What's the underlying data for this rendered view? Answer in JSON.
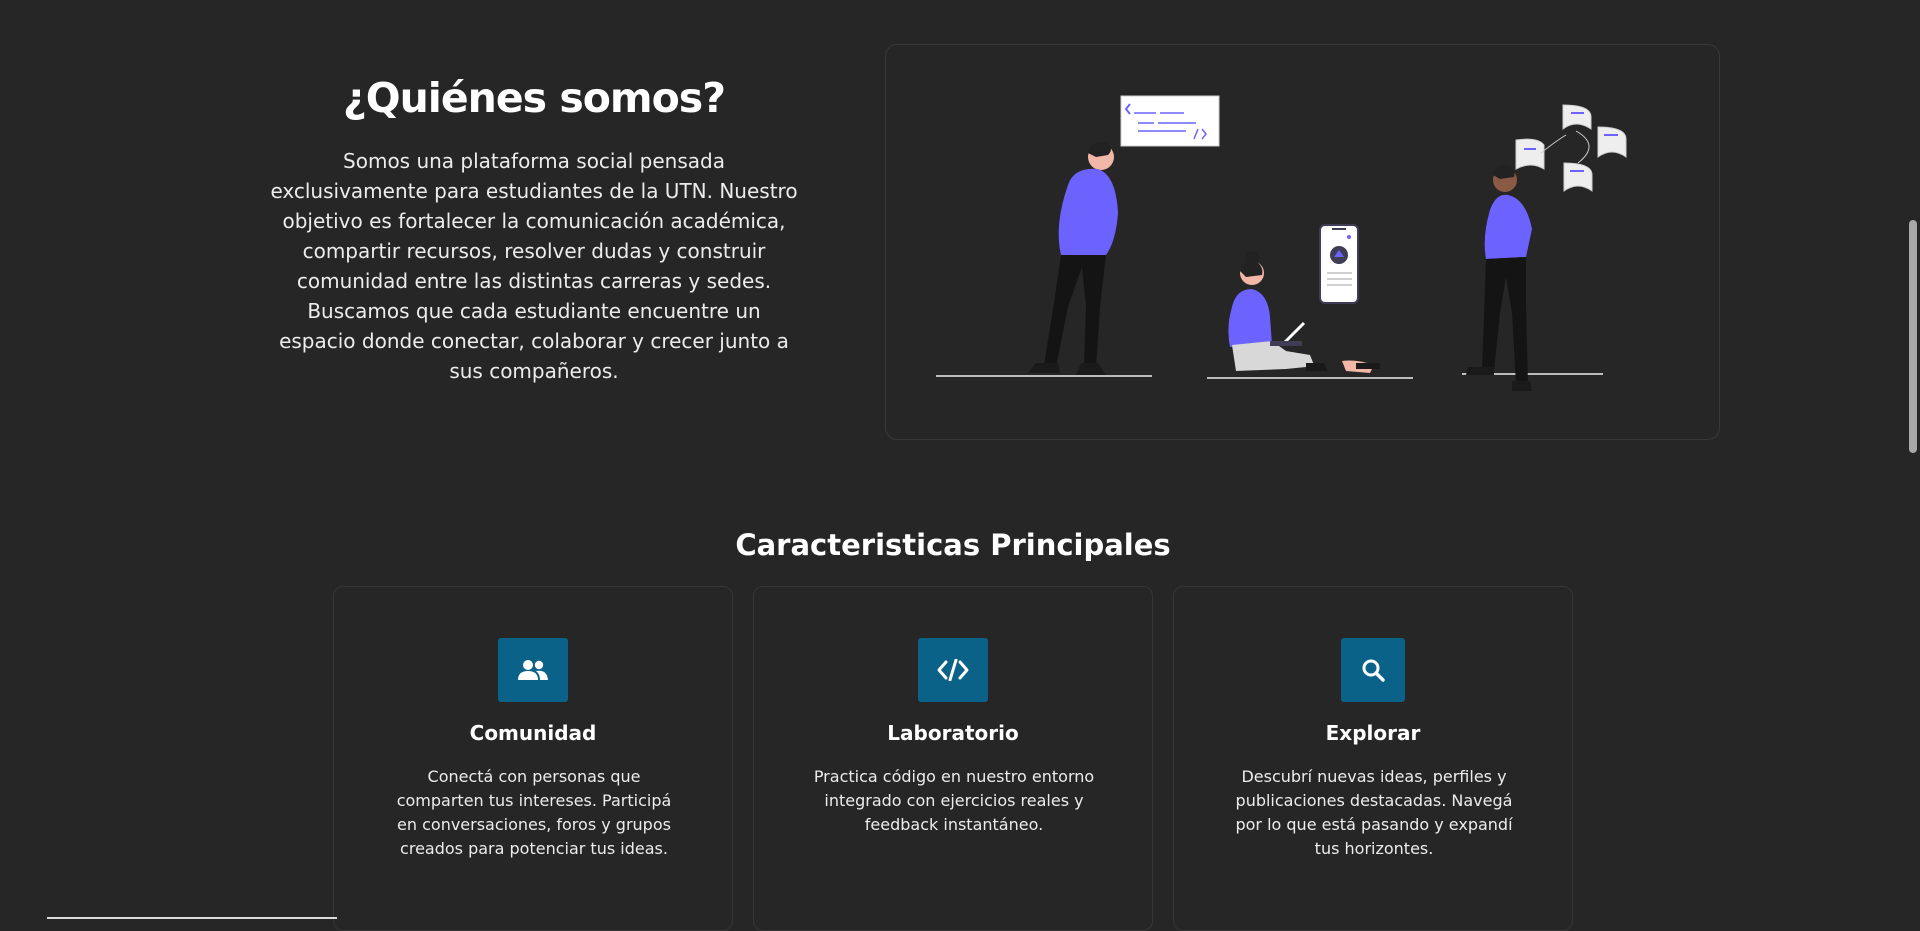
{
  "about": {
    "title": "¿Quiénes somos?",
    "description": "Somos una plataforma social pensada exclusivamente para estudiantes de la UTN. Nuestro objetivo es fortalecer la comunicación académica, compartir recursos, resolver dudas y construir comunidad entre las distintas carreras y sedes. Buscamos que cada estudiante encuentre un espacio donde conectar, colaborar y crecer junto a sus compañeros."
  },
  "features": {
    "title": "Caracteristicas Principales",
    "items": [
      {
        "name": "Comunidad",
        "icon": "users-icon",
        "description": "Conectá con personas que comparten tus intereses. Participá en conversaciones, foros y grupos creados para potenciar tus ideas."
      },
      {
        "name": "Laboratorio",
        "icon": "code-icon",
        "description": "Practica código en nuestro entorno integrado con ejercicios reales y feedback instantáneo."
      },
      {
        "name": "Explorar",
        "icon": "search-icon",
        "description": "Descubrí nuevas ideas, perfiles y publicaciones destacadas. Navegá por lo que está pasando y expandí tus horizontes."
      }
    ]
  },
  "colors": {
    "background": "#262626",
    "accent_purple": "#6c63ff",
    "icon_tile": "#0b6289"
  }
}
